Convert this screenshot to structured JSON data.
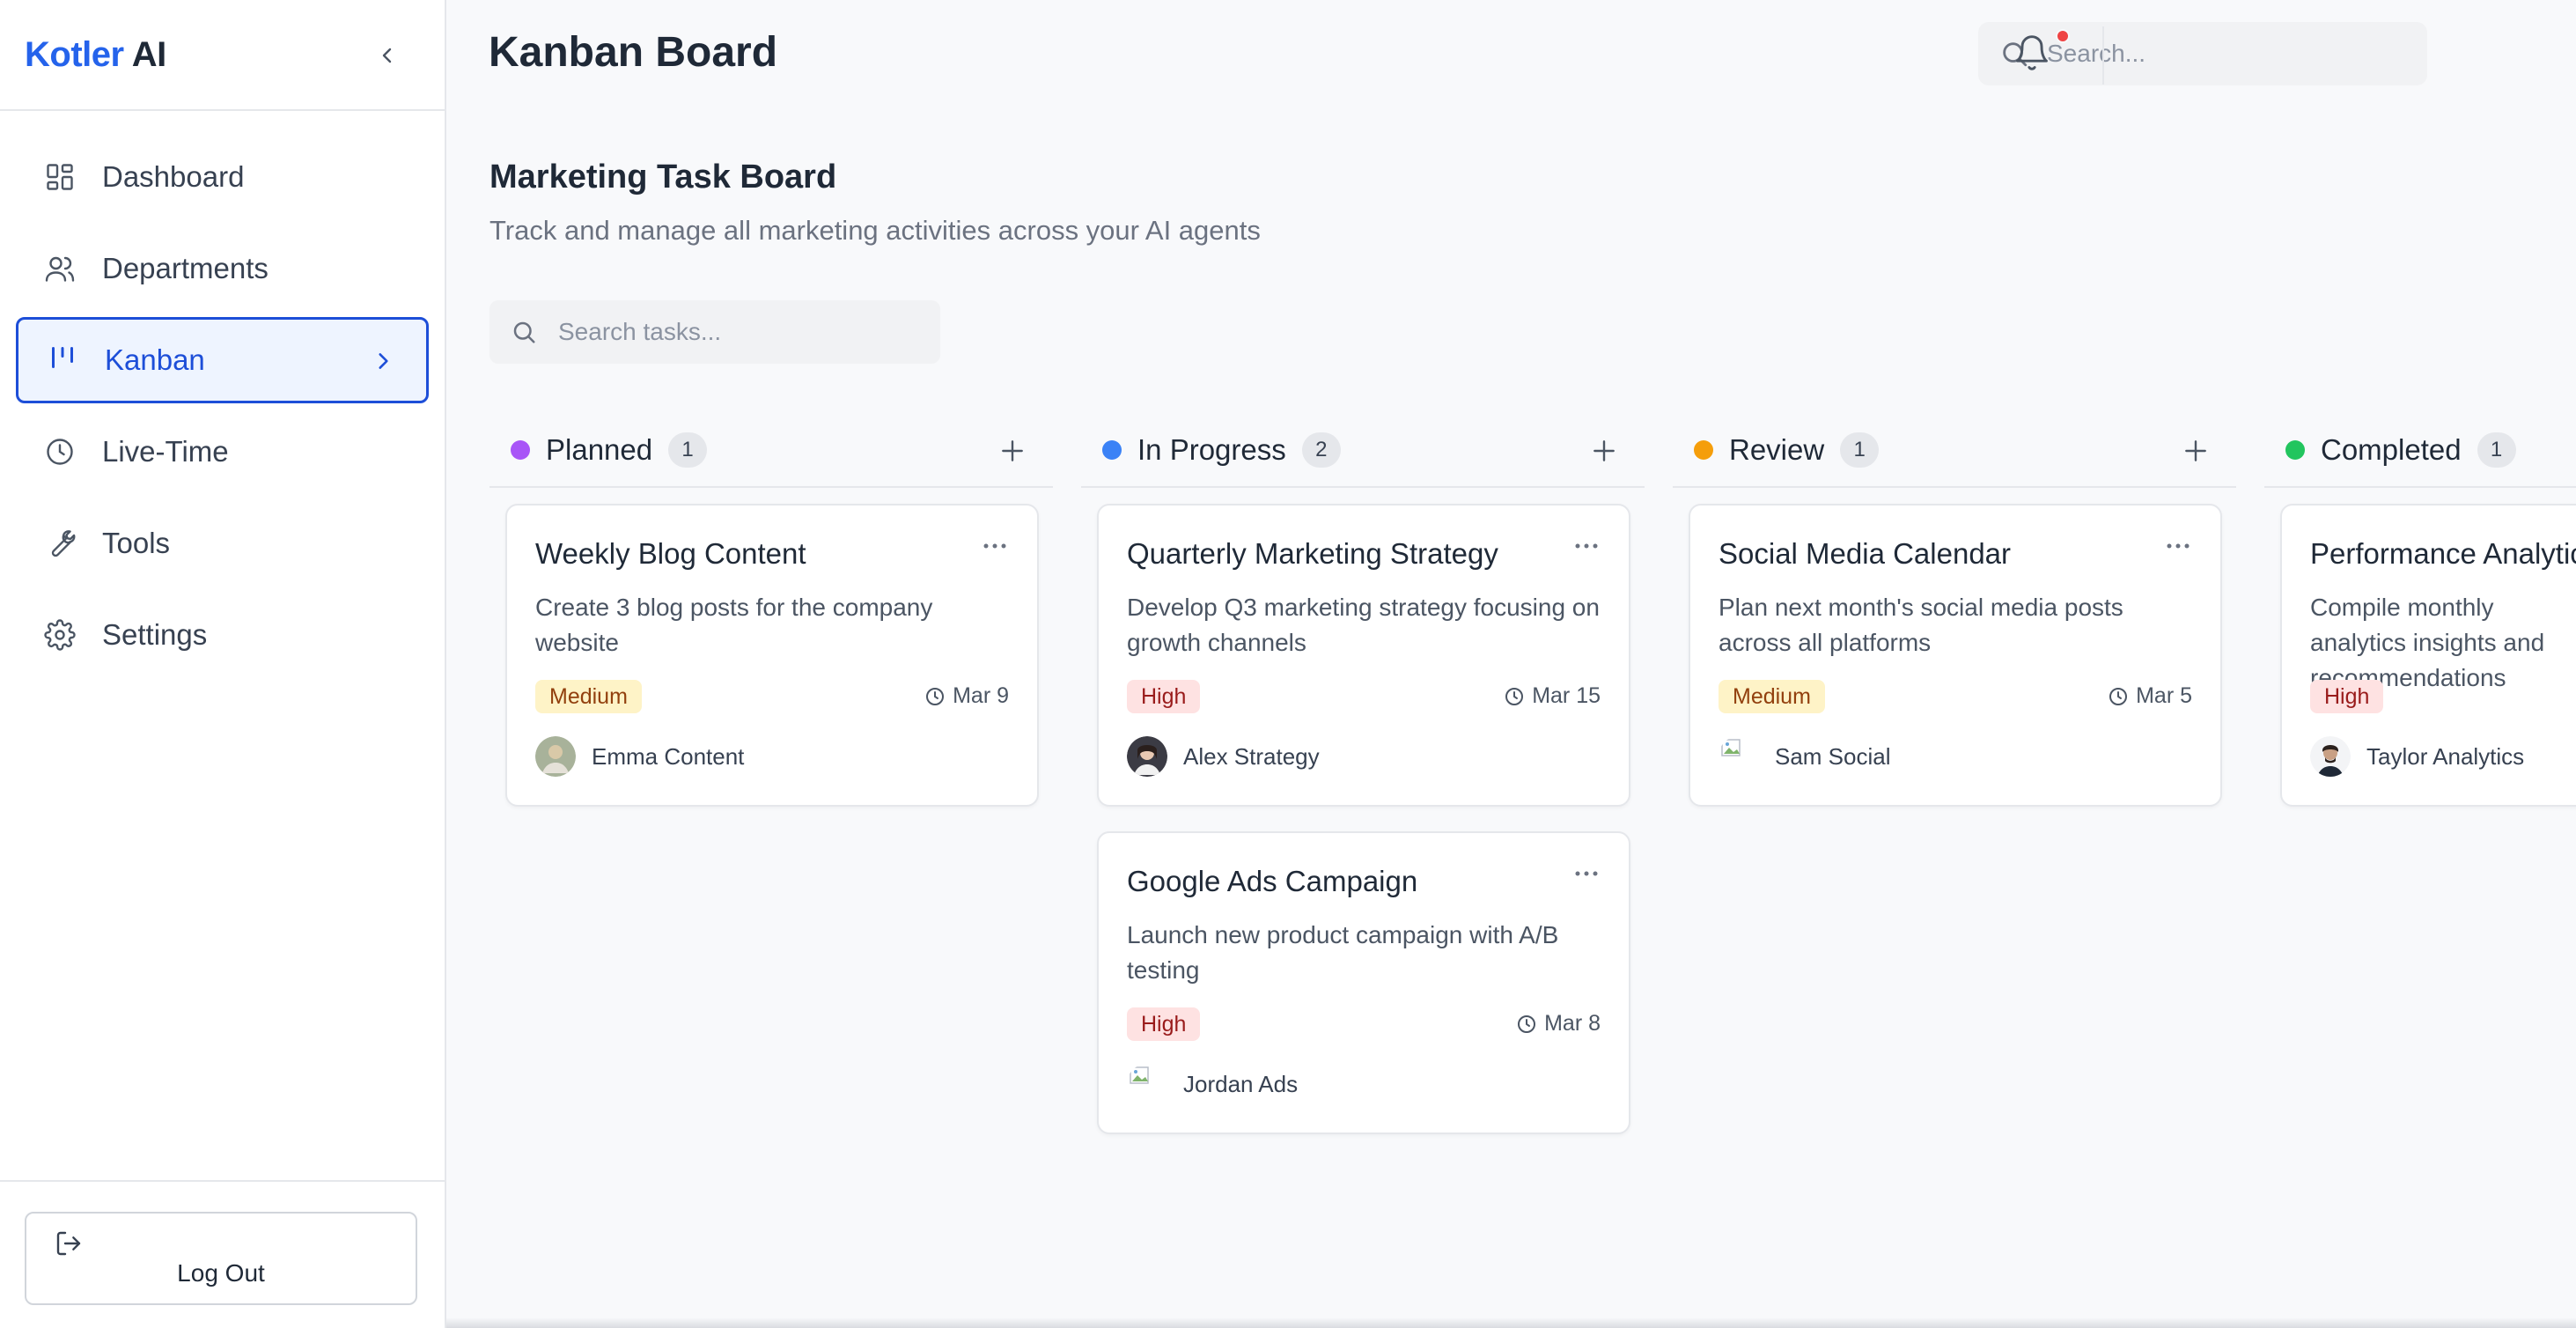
{
  "brand": {
    "part1": "Kotler",
    "part2": "AI"
  },
  "sidebar": {
    "items": [
      {
        "label": "Dashboard",
        "icon": "dashboard-icon"
      },
      {
        "label": "Departments",
        "icon": "users-icon"
      },
      {
        "label": "Kanban",
        "icon": "kanban-icon",
        "active": true
      },
      {
        "label": "Live-Time",
        "icon": "clock-icon"
      },
      {
        "label": "Tools",
        "icon": "wrench-icon"
      },
      {
        "label": "Settings",
        "icon": "gear-icon"
      }
    ],
    "logout_label": "Log Out"
  },
  "header": {
    "title": "Kanban Board",
    "search_placeholder": "Search...",
    "has_notification": true
  },
  "board": {
    "title": "Marketing Task Board",
    "subtitle": "Track and manage all marketing activities across your AI agents",
    "search_placeholder": "Search tasks..."
  },
  "colors": {
    "accent": "#2563eb",
    "planned": "#a855f7",
    "in_progress": "#3b82f6",
    "review": "#f59e0b",
    "completed": "#22c55e",
    "notification": "#ef4444"
  },
  "columns": [
    {
      "title": "Planned",
      "count": "1",
      "cards": [
        {
          "title": "Weekly Blog Content",
          "description": "Create 3 blog posts for the company website",
          "priority": "Medium",
          "due": "Mar 9",
          "assignee": "Emma Content"
        }
      ]
    },
    {
      "title": "In Progress",
      "count": "2",
      "cards": [
        {
          "title": "Quarterly Marketing Strategy",
          "description": "Develop Q3 marketing strategy focusing on growth channels",
          "priority": "High",
          "due": "Mar 15",
          "assignee": "Alex Strategy"
        },
        {
          "title": "Google Ads Campaign",
          "description": "Launch new product campaign with A/B testing",
          "priority": "High",
          "due": "Mar 8",
          "assignee": "Jordan Ads"
        }
      ]
    },
    {
      "title": "Review",
      "count": "1",
      "cards": [
        {
          "title": "Social Media Calendar",
          "description": "Plan next month's social media posts across all platforms",
          "priority": "Medium",
          "due": "Mar 5",
          "assignee": "Sam Social"
        }
      ]
    },
    {
      "title": "Completed",
      "count": "1",
      "cards": [
        {
          "title": "Performance Analytics",
          "description": "Compile monthly analytics insights and recommendations",
          "priority": "High",
          "due": "",
          "assignee": "Taylor Analytics"
        }
      ]
    }
  ]
}
